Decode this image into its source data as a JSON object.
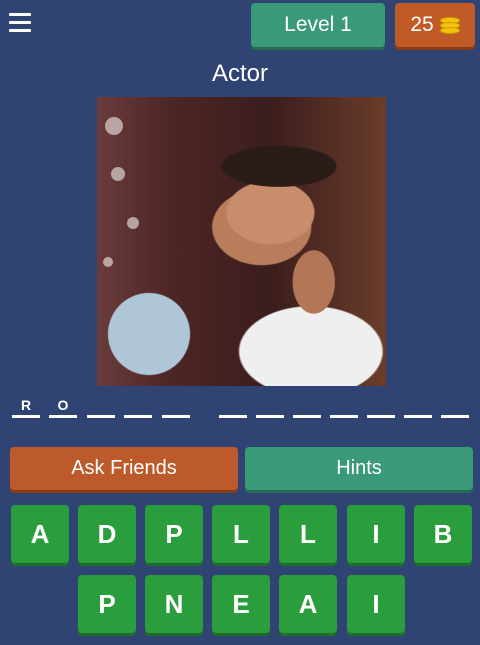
{
  "header": {
    "level_label": "Level 1",
    "coins": "25"
  },
  "category": "Actor",
  "answer_slots": [
    "R",
    "O",
    "",
    "",
    "",
    "",
    "",
    "",
    "",
    "",
    "",
    "",
    ""
  ],
  "actions": {
    "ask_friends": "Ask Friends",
    "hints": "Hints"
  },
  "keyboard": {
    "row1": [
      "A",
      "D",
      "P",
      "L",
      "L",
      "I",
      "B"
    ],
    "row2": [
      "P",
      "N",
      "E",
      "A",
      "I"
    ]
  },
  "colors": {
    "background": "#2f4472",
    "green_button": "#3a9a78",
    "orange_button": "#bd5a2b",
    "key_green": "#2a9d3c",
    "coin_gold": "#f4c20d"
  },
  "icons": [
    "menu-icon",
    "coin-stack-icon"
  ]
}
